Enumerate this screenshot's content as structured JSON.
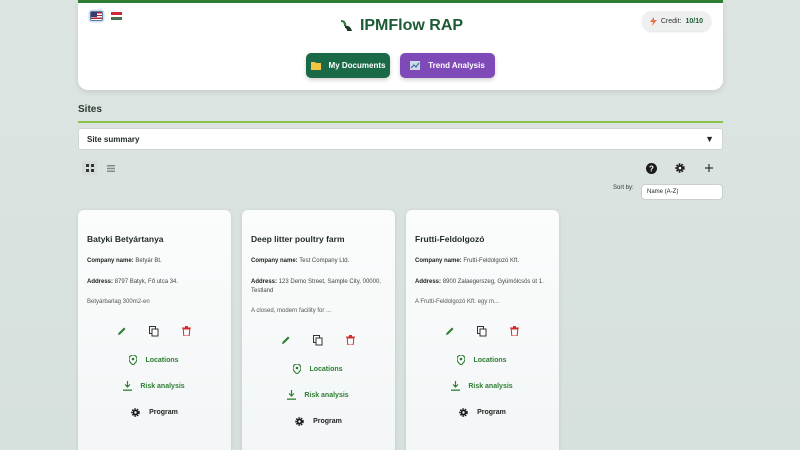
{
  "header": {
    "brand": "IPMFlow RAP",
    "credit_label": "Credit:",
    "credit_value": "10/10",
    "buttons": {
      "docs": "My Documents",
      "trend": "Trend Analysis"
    },
    "colors": {
      "brand_green": "#1b6a47",
      "trend_purple": "#7e4ab8",
      "accent_line": "#8bc34a"
    }
  },
  "languages": [
    "en-flag-icon",
    "hu-flag-icon"
  ],
  "sites": {
    "title": "Sites",
    "summary_label": "Site summary",
    "sort_label": "Sort by:",
    "sort_value": "Name (A-Z)"
  },
  "cards": [
    {
      "title": "Batyki Betyártanya",
      "company_label": "Company name:",
      "company": "Betyár Bt.",
      "address_label": "Address:",
      "address": "8797 Batyk, Fő utca 34.",
      "description": "Betyárbarlag 300m2-en",
      "locations": "Locations",
      "risk": "Risk analysis",
      "program": "Program"
    },
    {
      "title": "Deep litter poultry farm",
      "company_label": "Company name:",
      "company": "Test Company Ltd.",
      "address_label": "Address:",
      "address": "123 Demo Street, Sample City, 00000, Testland",
      "description": "A closed, modern facility for ...",
      "locations": "Locations",
      "risk": "Risk analysis",
      "program": "Program"
    },
    {
      "title": "Frutti-Feldolgozó",
      "company_label": "Company name:",
      "company": "Frutti-Feldolgozó Kft.",
      "address_label": "Address:",
      "address": "8900 Zalaegerszeg, Gyümölcsös út 1.",
      "description": "A Frutti-Feldolgozó Kft. egy m...",
      "locations": "Locations",
      "risk": "Risk analysis",
      "program": "Program"
    }
  ]
}
